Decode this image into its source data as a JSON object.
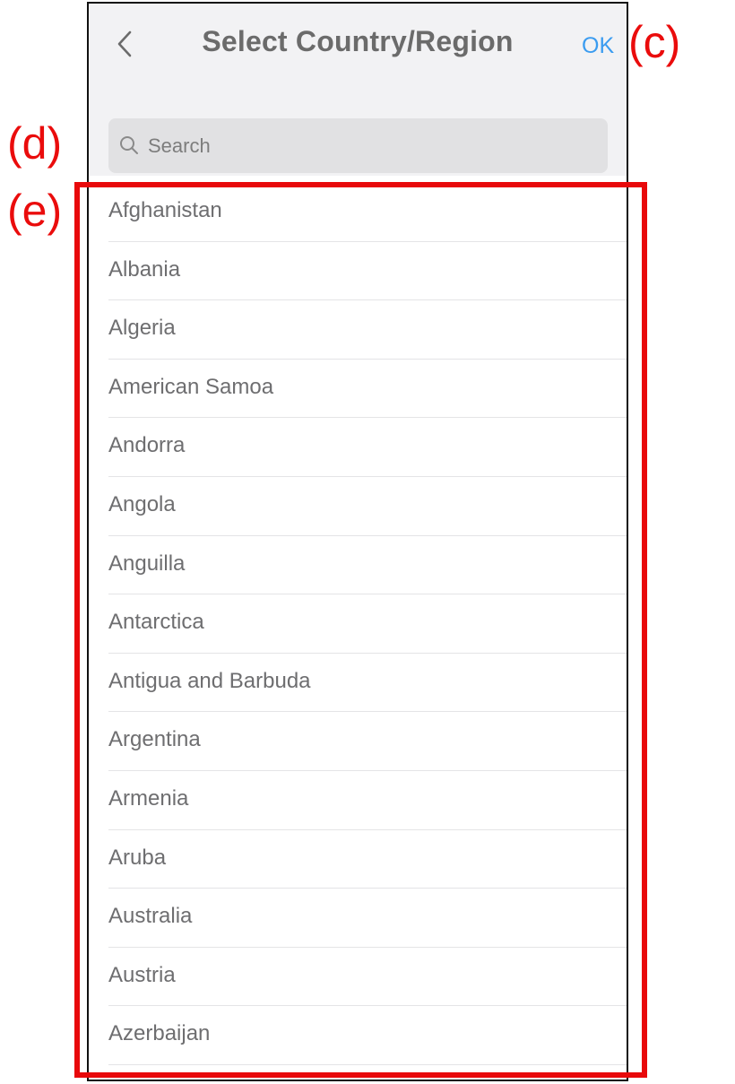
{
  "header": {
    "back_icon": "chevron-left-icon",
    "title": "Select Country/Region",
    "ok_label": "OK"
  },
  "search": {
    "icon": "search-icon",
    "placeholder": "Search",
    "value": ""
  },
  "countries": [
    "Afghanistan",
    "Albania",
    "Algeria",
    "American Samoa",
    "Andorra",
    "Angola",
    "Anguilla",
    "Antarctica",
    "Antigua and Barbuda",
    "Argentina",
    "Armenia",
    "Aruba",
    "Australia",
    "Austria",
    "Azerbaijan"
  ],
  "annotations": {
    "c": "(c)",
    "d": "(d)",
    "e": "(e)"
  },
  "colors": {
    "accent": "#3b9cf0",
    "annotation": "#e8090b",
    "header_bg": "#f2f2f4"
  }
}
